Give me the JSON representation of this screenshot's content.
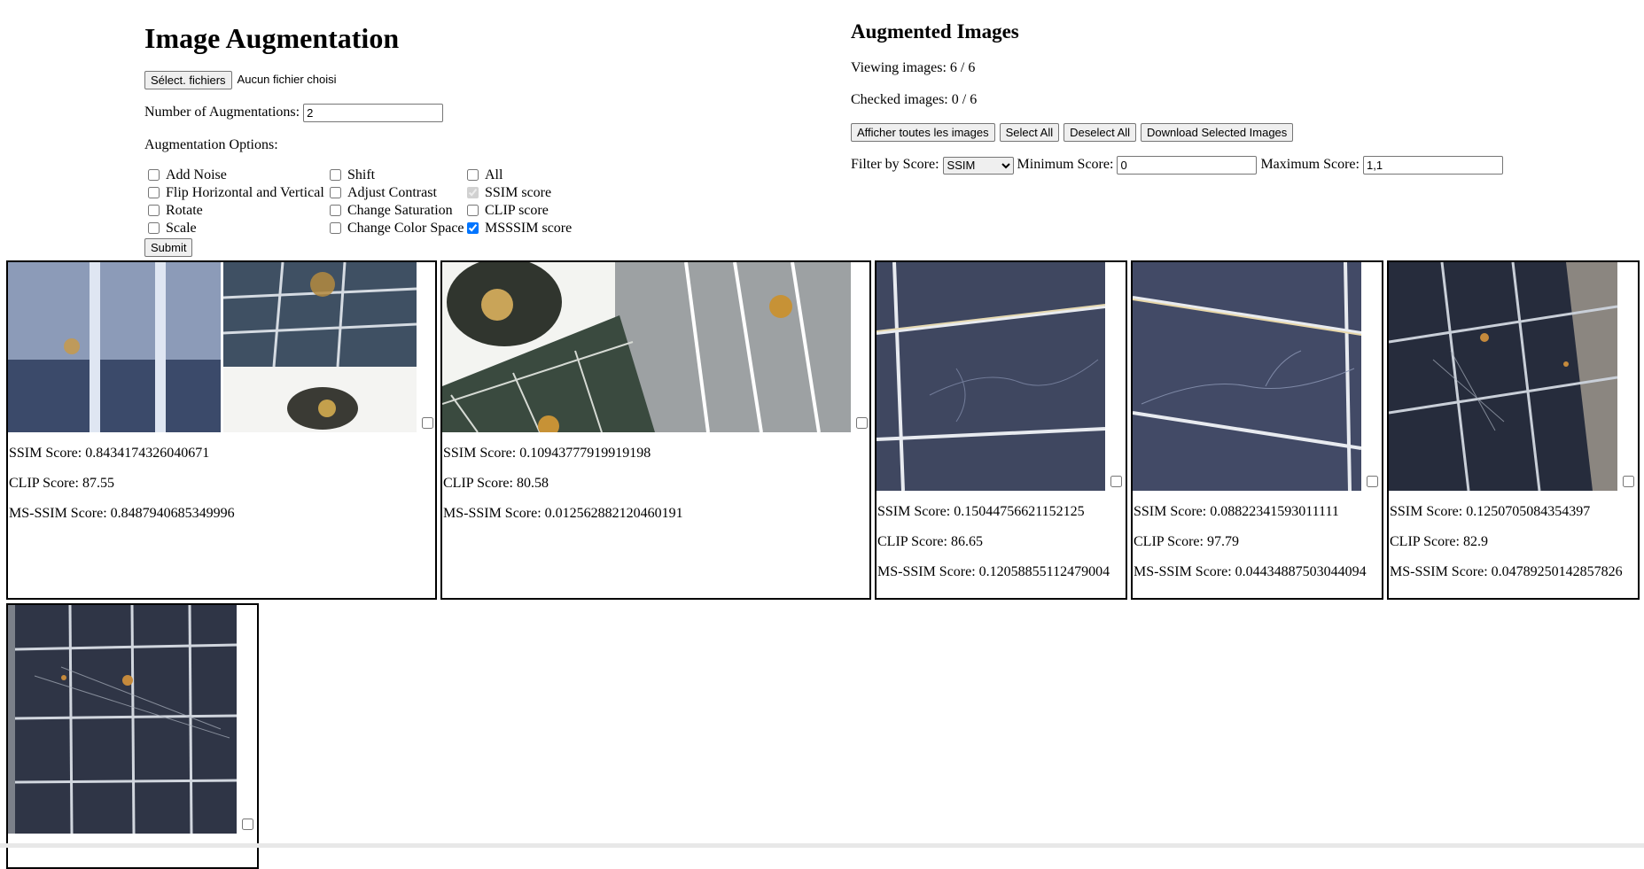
{
  "left": {
    "title": "Image Augmentation",
    "file_button": "Sélect. fichiers",
    "file_status": "Aucun fichier choisi",
    "num_aug_label": "Number of Augmentations:",
    "num_aug_value": "2",
    "options_label": "Augmentation Options:",
    "options": {
      "col1": [
        {
          "label": "Add Noise",
          "checked": false
        },
        {
          "label": "Flip Horizontal and Vertical",
          "checked": false
        },
        {
          "label": "Rotate",
          "checked": false
        },
        {
          "label": "Scale",
          "checked": false
        }
      ],
      "col2": [
        {
          "label": "Shift",
          "checked": false
        },
        {
          "label": "Adjust Contrast",
          "checked": false
        },
        {
          "label": "Change Saturation",
          "checked": false
        },
        {
          "label": "Change Color Space",
          "checked": false
        }
      ],
      "col3": [
        {
          "label": "All",
          "checked": false
        },
        {
          "label": "SSIM score",
          "checked": true,
          "disabled": true
        },
        {
          "label": "CLIP score",
          "checked": false
        },
        {
          "label": "MSSSIM score",
          "checked": true
        }
      ]
    },
    "submit": "Submit"
  },
  "right": {
    "title": "Augmented Images",
    "viewing": "Viewing images: 6 / 6",
    "checked": "Checked images: 0 / 6",
    "buttons": {
      "show_all": "Afficher toutes les images",
      "select_all": "Select All",
      "deselect_all": "Deselect All",
      "download": "Download Selected Images"
    },
    "filter_label": "Filter by Score:",
    "filter_selected": "SSIM",
    "min_label": "Minimum Score:",
    "min_value": "0",
    "max_label": "Maximum Score:",
    "max_value": "1,1"
  },
  "cards": [
    {
      "ssim": "SSIM Score: 0.8434174326040671",
      "clip": "CLIP Score: 87.55",
      "msssim": "MS-SSIM Score: 0.8487940685349996"
    },
    {
      "ssim": "SSIM Score: 0.10943777919919198",
      "clip": "CLIP Score: 80.58",
      "msssim": "MS-SSIM Score: 0.012562882120460191"
    },
    {
      "ssim": "SSIM Score: 0.15044756621152125",
      "clip": "CLIP Score: 86.65",
      "msssim": "MS-SSIM Score: 0.12058855112479004"
    },
    {
      "ssim": "SSIM Score: 0.08822341593011111",
      "clip": "CLIP Score: 97.79",
      "msssim": "MS-SSIM Score: 0.04434887503044094"
    },
    {
      "ssim": "SSIM Score: 0.1250705084354397",
      "clip": "CLIP Score: 82.9",
      "msssim": "MS-SSIM Score: 0.04789250142857826"
    },
    {
      "ssim": "",
      "clip": "",
      "msssim": ""
    }
  ],
  "colors": {
    "button_bg": "#efefef",
    "border": "#767676",
    "card_border": "#000000",
    "checkbox_accent": "#0075ff"
  }
}
